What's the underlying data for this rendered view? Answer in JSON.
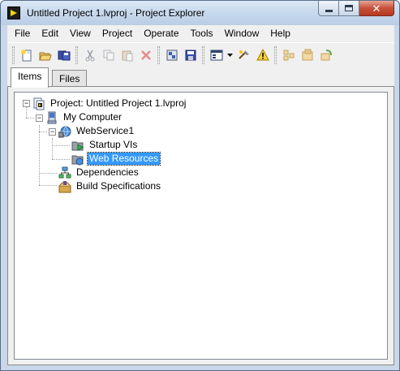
{
  "window": {
    "title": "Untitled Project 1.lvproj - Project Explorer",
    "close_symbol": "✕"
  },
  "menu": [
    {
      "label": "File"
    },
    {
      "label": "Edit"
    },
    {
      "label": "View"
    },
    {
      "label": "Project"
    },
    {
      "label": "Operate"
    },
    {
      "label": "Tools"
    },
    {
      "label": "Window"
    },
    {
      "label": "Help"
    }
  ],
  "toolbar": {
    "buttons": [
      "new-icon",
      "open-icon",
      "save-all-icon",
      "cut-icon",
      "copy-icon",
      "paste-icon",
      "delete-icon",
      "build-icon",
      "save-project-icon",
      "view-icon",
      "dropdown-arrow-icon",
      "resolve-icon",
      "warning-icon",
      "collapse-icon",
      "expand-icon",
      "filter-icon"
    ]
  },
  "tabs": [
    {
      "label": "Items",
      "active": true
    },
    {
      "label": "Files",
      "active": false
    }
  ],
  "tree": {
    "expander_minus": "−",
    "nodes": [
      {
        "label": "Project: Untitled Project 1.lvproj",
        "icon": "project-icon",
        "selected": false
      },
      {
        "label": "My Computer",
        "icon": "computer-icon",
        "selected": false
      },
      {
        "label": "WebService1",
        "icon": "web-service-icon",
        "selected": false
      },
      {
        "label": "Startup VIs",
        "icon": "startup-folder-icon",
        "selected": false
      },
      {
        "label": "Web Resources",
        "icon": "web-resources-folder-icon",
        "selected": true
      },
      {
        "label": "Dependencies",
        "icon": "dependencies-icon",
        "selected": false
      },
      {
        "label": "Build Specifications",
        "icon": "build-specifications-icon",
        "selected": false
      }
    ]
  },
  "colors": {
    "selection": "#3399ff",
    "window_frame": "#c8d8ea",
    "close_button": "#c7503a"
  }
}
